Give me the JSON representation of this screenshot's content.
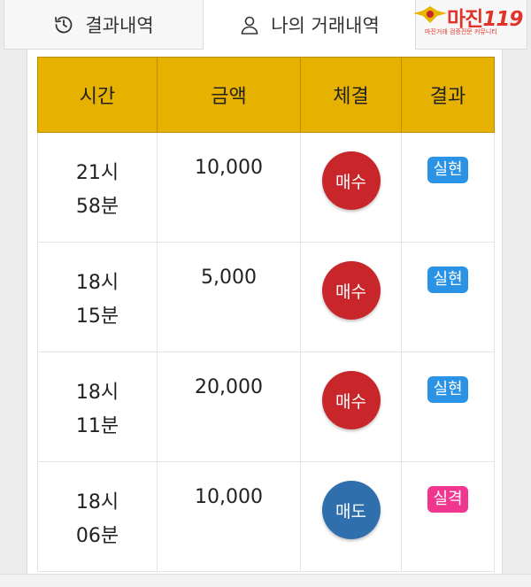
{
  "tabs": [
    {
      "label": "결과내역",
      "icon": "history-icon"
    },
    {
      "label": "나의 거래내역",
      "icon": "user-icon"
    }
  ],
  "logo": {
    "text": "마진",
    "suffix": "119",
    "sub": "마진거래 검증전문 커뮤니티"
  },
  "table": {
    "headers": [
      "시간",
      "금액",
      "체결",
      "결과"
    ],
    "rows": [
      {
        "hour": "21시",
        "minute": "58분",
        "amount": "10,000",
        "exec": "매수",
        "exec_color": "#c8262b",
        "result": "실현",
        "result_color": "#2a93e6"
      },
      {
        "hour": "18시",
        "minute": "15분",
        "amount": "5,000",
        "exec": "매수",
        "exec_color": "#c8262b",
        "result": "실현",
        "result_color": "#2a93e6"
      },
      {
        "hour": "18시",
        "minute": "11분",
        "amount": "20,000",
        "exec": "매수",
        "exec_color": "#c8262b",
        "result": "실현",
        "result_color": "#2a93e6"
      },
      {
        "hour": "18시",
        "minute": "06분",
        "amount": "10,000",
        "exec": "매도",
        "exec_color": "#2f6fae",
        "result": "실격",
        "result_color": "#f0368f"
      }
    ]
  }
}
